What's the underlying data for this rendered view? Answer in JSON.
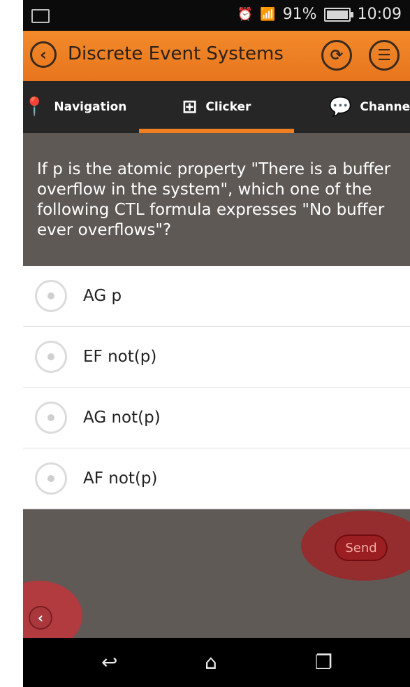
{
  "status": {
    "battery": "91%",
    "time": "10:09"
  },
  "appbar": {
    "title": "Discrete Event Systems",
    "back_icon": "chevron-left-icon",
    "refresh_icon": "refresh-icon",
    "menu_icon": "list-menu-icon",
    "accent": "#f07e23"
  },
  "tabs": [
    {
      "label": "Navigation",
      "icon": "map-pin-icon"
    },
    {
      "label": "Clicker",
      "icon": "clicker-icon",
      "active": true
    },
    {
      "label": "Channe",
      "icon": "chat-icon"
    }
  ],
  "question": {
    "text": "If p is the atomic property \"There is a buffer overflow in the system\", which one of the following CTL formula expresses \"No buffer ever overflows\"?"
  },
  "options": [
    {
      "label": "AG p"
    },
    {
      "label": "EF not(p)"
    },
    {
      "label": "AG not(p)"
    },
    {
      "label": "AF not(p)"
    }
  ],
  "actions": {
    "send_label": "Send"
  }
}
